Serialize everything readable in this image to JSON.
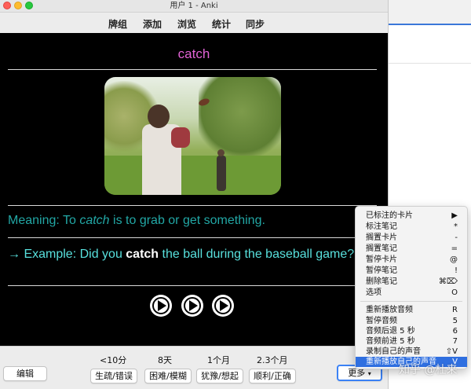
{
  "window": {
    "title": "用户 1 - Anki"
  },
  "toolbar": {
    "decks": "牌组",
    "add": "添加",
    "browse": "浏览",
    "stats": "统计",
    "sync": "同步"
  },
  "card": {
    "word": "catch",
    "meaning_prefix": "Meaning: To ",
    "meaning_em": "catch",
    "meaning_suffix": " is to grab or get something.",
    "example_prefix": "→ Example: Did you ",
    "example_bold": "catch",
    "example_suffix": " the ball during the baseball game?",
    "play_icon": "play-circle-icon"
  },
  "answer": {
    "again_ivl": "<10分",
    "hard_ivl": "8天",
    "good_ivl": "1个月",
    "easy_ivl": "2.3个月",
    "again": "生疏/错误",
    "hard": "困难/模糊",
    "good": "犹豫/想起",
    "easy": "顺利/正确",
    "edit": "编辑",
    "more": "更多"
  },
  "menu": {
    "items": [
      {
        "label": "已标注的卡片",
        "shortcut": "▶"
      },
      {
        "label": "标注笔记",
        "shortcut": "*"
      },
      {
        "label": "搁置卡片",
        "shortcut": "-"
      },
      {
        "label": "搁置笔记",
        "shortcut": "="
      },
      {
        "label": "暂停卡片",
        "shortcut": "@"
      },
      {
        "label": "暂停笔记",
        "shortcut": "!"
      },
      {
        "label": "删除笔记",
        "shortcut": "⌘⌦"
      },
      {
        "label": "选项",
        "shortcut": "O"
      },
      {
        "label": "重新播放音频",
        "shortcut": "R"
      },
      {
        "label": "暂停音频",
        "shortcut": "5"
      },
      {
        "label": "音频后退 5 秒",
        "shortcut": "6"
      },
      {
        "label": "音频前进 5 秒",
        "shortcut": "7"
      },
      {
        "label": "录制自己的声音",
        "shortcut": "⇧V"
      },
      {
        "label": "重新播放自己的声音",
        "shortcut": "V"
      }
    ]
  },
  "watermark": "知乎 @杜来"
}
